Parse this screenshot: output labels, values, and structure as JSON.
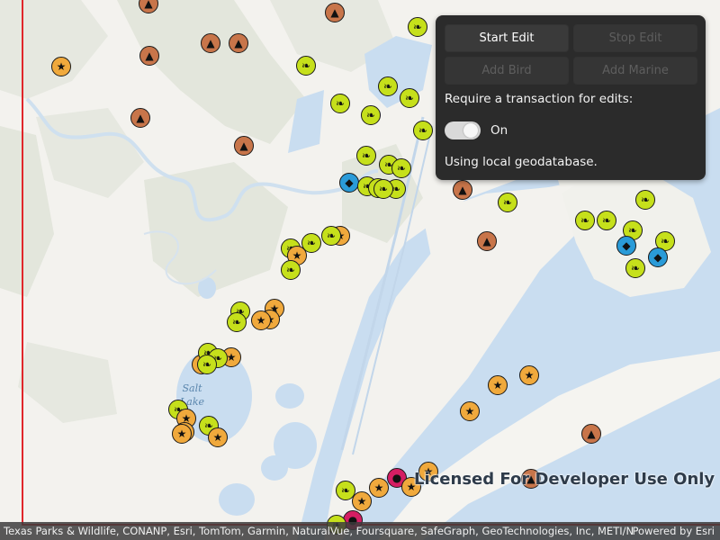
{
  "map": {
    "lake_label_line1": "Salt",
    "lake_label_line2": "Lake",
    "watermark": "Licensed For Developer Use Only",
    "attribution": "Texas Parks & Wildlife, CONANP, Esri, TomTom, Garmin, NaturalVue, Foursquare, SafeGraph, GeoTechnologies, Inc, METI/NASA, US...",
    "powered_by": "Powered by Esri",
    "colors": {
      "land": "#f3f2ee",
      "vegetation": "#e3e6dc",
      "water": "#c9ddf0",
      "extent_outline": "#e0262b",
      "bird_marker": "#c6e01b",
      "marine_mammal_marker": "#c8754a",
      "fish_marker": "#2a9bd8",
      "invertebrate_marker": "#f0a93c",
      "crab_marker": "#d41e63"
    },
    "symbol_legend": {
      "bird": "bird-icon",
      "marine_mammal": "marine-mammal-icon",
      "fish": "fish-icon",
      "invertebrate": "starfish-icon",
      "crab": "crab-icon"
    }
  },
  "panel": {
    "start_edit": "Start Edit",
    "stop_edit": "Stop Edit",
    "add_bird": "Add Bird",
    "add_marine": "Add Marine",
    "transaction_label": "Require a transaction for edits:",
    "toggle_state": "On",
    "toggle_on": true,
    "status": "Using local geodatabase."
  }
}
